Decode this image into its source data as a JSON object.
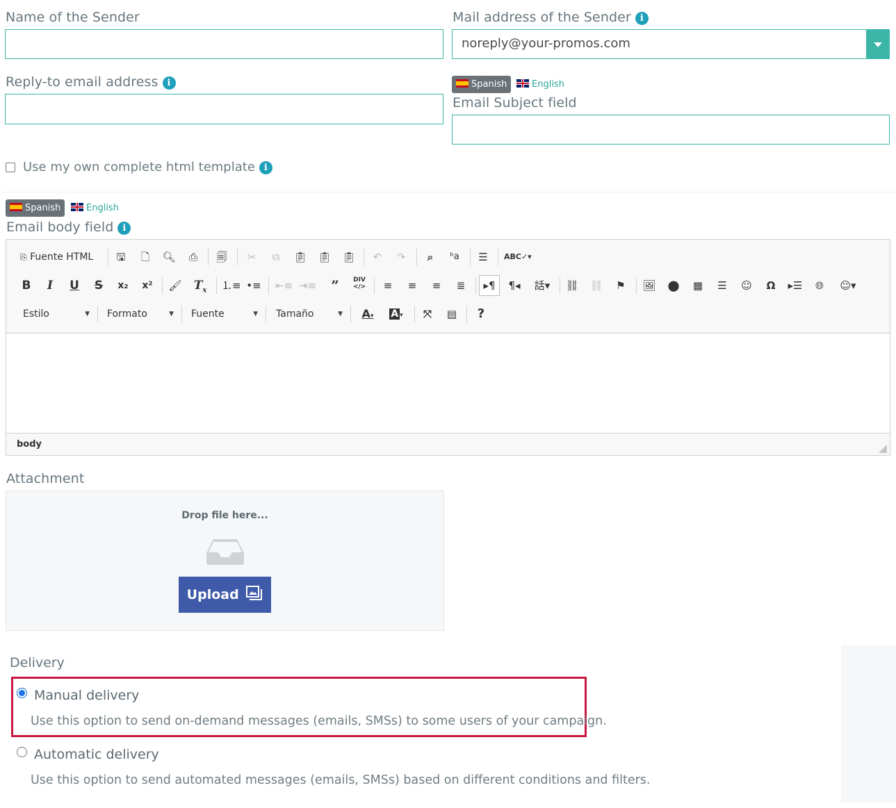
{
  "sender": {
    "name_label": "Name of the Sender",
    "name_value": "",
    "mail_label": "Mail address of the Sender",
    "mail_value": "noreply@your-promos.com"
  },
  "reply_to": {
    "label": "Reply-to email address",
    "value": ""
  },
  "subject": {
    "lang_active": "Spanish",
    "lang_other": "English",
    "label": "Email Subject field",
    "value": ""
  },
  "own_template": {
    "label": "Use my own complete html template",
    "checked": false
  },
  "body": {
    "lang_active": "Spanish",
    "lang_other": "English",
    "label": "Email body field",
    "toolbar": {
      "source_label": "Fuente HTML",
      "combos": [
        "Estilo",
        "Formato",
        "Fuente",
        "Tamaño"
      ]
    },
    "status_path": "body"
  },
  "attachment": {
    "label": "Attachment",
    "drop_text": "Drop file here...",
    "upload_label": "Upload"
  },
  "delivery": {
    "label": "Delivery",
    "options": [
      {
        "title": "Manual delivery",
        "desc": "Use this option to send on-demand messages (emails, SMSs) to some users of your campaign.",
        "selected": true
      },
      {
        "title": "Automatic delivery",
        "desc": "Use this option to send automated messages (emails, SMSs) based on different conditions and filters.",
        "selected": false
      }
    ]
  },
  "colors": {
    "accent": "#3ab5a7",
    "info": "#1f9fba",
    "upload": "#3f5aa9",
    "highlight": "#c8173f"
  }
}
